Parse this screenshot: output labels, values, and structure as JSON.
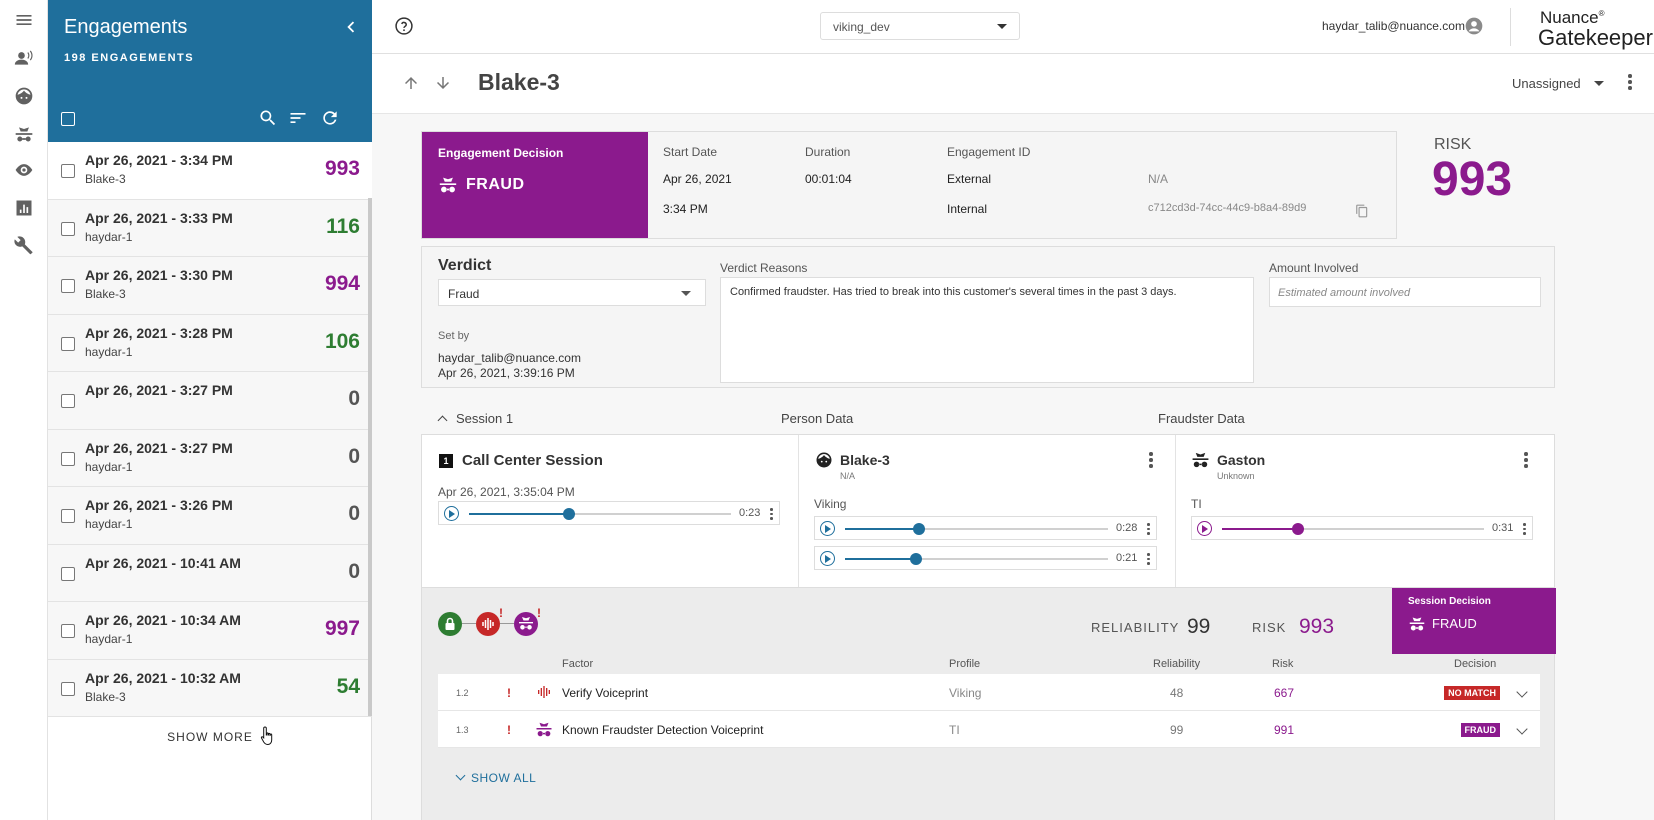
{
  "panel": {
    "title": "Engagements",
    "count": "198 ENGAGEMENTS",
    "show_more": "SHOW MORE",
    "items": [
      {
        "date": "Apr 26, 2021 - 3:34 PM",
        "who": "Blake-3",
        "score": "993",
        "color": "#8b1a8d"
      },
      {
        "date": "Apr 26, 2021 - 3:33 PM",
        "who": "haydar-1",
        "score": "116",
        "color": "#2e7d32"
      },
      {
        "date": "Apr 26, 2021 - 3:30 PM",
        "who": "Blake-3",
        "score": "994",
        "color": "#8b1a8d"
      },
      {
        "date": "Apr 26, 2021 - 3:28 PM",
        "who": "haydar-1",
        "score": "106",
        "color": "#2e7d32"
      },
      {
        "date": "Apr 26, 2021 - 3:27 PM",
        "who": "",
        "score": "0",
        "color": "#555555"
      },
      {
        "date": "Apr 26, 2021 - 3:27 PM",
        "who": "haydar-1",
        "score": "0",
        "color": "#555555"
      },
      {
        "date": "Apr 26, 2021 - 3:26 PM",
        "who": "haydar-1",
        "score": "0",
        "color": "#555555"
      },
      {
        "date": "Apr 26, 2021 - 10:41 AM",
        "who": "",
        "score": "0",
        "color": "#555555"
      },
      {
        "date": "Apr 26, 2021 - 10:34 AM",
        "who": "haydar-1",
        "score": "997",
        "color": "#8b1a8d"
      },
      {
        "date": "Apr 26, 2021 - 10:32 AM",
        "who": "Blake-3",
        "score": "54",
        "color": "#2e7d32"
      }
    ]
  },
  "topbar": {
    "environment": "viking_dev",
    "user": "haydar_talib@nuance.com",
    "brand_line1": "Nuance",
    "brand_mark": "®",
    "brand_line2": "Gatekeeper"
  },
  "engagement": {
    "title": "Blake-3",
    "assignee": "Unassigned",
    "decision_label": "Engagement Decision",
    "decision": "FRAUD",
    "start_date_label": "Start Date",
    "start_date": "Apr 26, 2021",
    "start_time": "3:34 PM",
    "duration_label": "Duration",
    "duration": "00:01:04",
    "id_label": "Engagement ID",
    "external_label": "External",
    "external_value": "N/A",
    "internal_label": "Internal",
    "internal_value": "c712cd3d-74cc-44c9-b8a4-89d9",
    "risk_label": "RISK",
    "risk": "993"
  },
  "verdict": {
    "title": "Verdict",
    "selected": "Fraud",
    "set_by_label": "Set by",
    "set_by_user": "haydar_talib@nuance.com",
    "set_by_time": "Apr 26, 2021, 3:39:16 PM",
    "reasons_label": "Verdict Reasons",
    "reasons": "Confirmed fraudster. Has tried to break into this customer's several times in the past 3 days.",
    "amount_label": "Amount Involved",
    "amount_placeholder": "Estimated amount involved"
  },
  "session": {
    "label": "Session 1",
    "person_header": "Person Data",
    "fraudster_header": "Fraudster Data",
    "call": {
      "badge": "1",
      "title": "Call Center Session",
      "date": "Apr 26, 2021, 3:35:04 PM",
      "time": "0:23",
      "progress": 0.38
    },
    "person": {
      "name": "Blake-3",
      "sub": "N/A",
      "group": "Viking",
      "audio": [
        {
          "time": "0:28",
          "progress": 0.28
        },
        {
          "time": "0:21",
          "progress": 0.27
        }
      ]
    },
    "fraudster": {
      "name": "Gaston",
      "sub": "Unknown",
      "group": "TI",
      "audio": [
        {
          "time": "0:31",
          "progress": 0.29
        }
      ]
    },
    "reliability_label": "RELIABILITY",
    "reliability": "99",
    "risk_label": "RISK",
    "risk": "993",
    "decision_label": "Session Decision",
    "decision": "FRAUD"
  },
  "factors": {
    "headers": {
      "factor": "Factor",
      "profile": "Profile",
      "reliability": "Reliability",
      "risk": "Risk",
      "decision": "Decision"
    },
    "rows": [
      {
        "id": "1.2",
        "flag": "!",
        "name": "Verify Voiceprint",
        "profile": "Viking",
        "reliability": "48",
        "risk": "667",
        "decision": "NO MATCH",
        "tag_color": "#c62828"
      },
      {
        "id": "1.3",
        "flag": "!",
        "name": "Known Fraudster Detection Voiceprint",
        "profile": "TI",
        "reliability": "99",
        "risk": "991",
        "decision": "FRAUD",
        "tag_color": "#8b1a8d"
      }
    ],
    "show_all": "SHOW ALL"
  },
  "colors": {
    "accent": "#1f6f9c",
    "fraud": "#8b1a8d",
    "safe": "#2e7d32",
    "alert": "#c62828"
  }
}
